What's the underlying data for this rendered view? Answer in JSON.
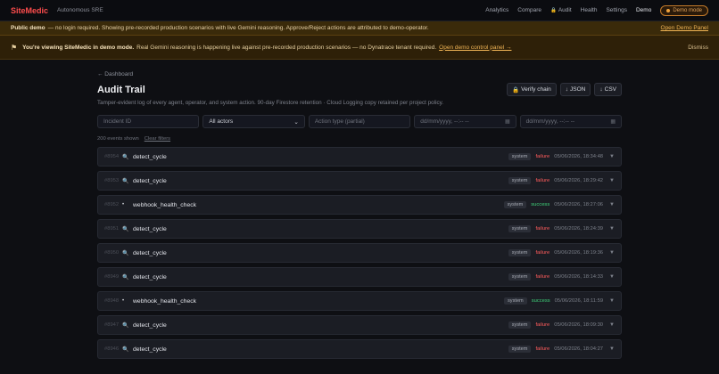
{
  "nav": {
    "brand": "SiteMedic",
    "subtitle": "Autonomous SRE",
    "links": [
      "Analytics",
      "Compare",
      "Audit",
      "Health",
      "Settings",
      "Demo"
    ],
    "demo_pill": "Demo mode"
  },
  "banner_public": {
    "bold": "Public demo",
    "text": "— no login required. Showing pre-recorded production scenarios with live Gemini reasoning. Approve/Reject actions are attributed to demo-operator.",
    "link": "Open Demo Panel"
  },
  "banner_demo": {
    "bold": "You're viewing SiteMedic in demo mode.",
    "text": "Real Gemini reasoning is happening live against pre-recorded production scenarios — no Dynatrace tenant required.",
    "link": "Open demo control panel →",
    "dismiss": "Dismiss"
  },
  "page": {
    "back": "← Dashboard",
    "title": "Audit Trail",
    "verify": "Verify chain",
    "json": "JSON",
    "csv": "CSV",
    "description": "Tamper-evident log of every agent, operator, and system action. 90-day Firestore retention · Cloud Logging copy retained per project policy."
  },
  "filters": {
    "incident_placeholder": "Incident ID",
    "actors_value": "All actors",
    "action_placeholder": "Action type (partial)",
    "date_from": "dd/mm/yyyy, --:-- --",
    "date_to": "dd/mm/yyyy, --:-- --"
  },
  "summary": {
    "count": "200 events shown",
    "clear": "Clear filters"
  },
  "colors": {
    "brand": "#ff4d4d",
    "failure": "#ff5c5c",
    "success": "#3fd27a",
    "banner": "#3a2a0a"
  },
  "events": [
    {
      "id": "#8954",
      "icon": "magnifier-icon",
      "action": "detect_cycle",
      "actor": "system",
      "status": "failure",
      "time": "05/06/2026, 18:34:48"
    },
    {
      "id": "#8953",
      "icon": "magnifier-icon",
      "action": "detect_cycle",
      "actor": "system",
      "status": "failure",
      "time": "05/06/2026, 18:29:42"
    },
    {
      "id": "#8952",
      "icon": "dot-icon",
      "action": "webhook_health_check",
      "actor": "system",
      "status": "success",
      "time": "05/06/2026, 18:27:06"
    },
    {
      "id": "#8951",
      "icon": "magnifier-icon",
      "action": "detect_cycle",
      "actor": "system",
      "status": "failure",
      "time": "05/06/2026, 18:24:39"
    },
    {
      "id": "#8950",
      "icon": "magnifier-icon",
      "action": "detect_cycle",
      "actor": "system",
      "status": "failure",
      "time": "05/06/2026, 18:19:36"
    },
    {
      "id": "#8949",
      "icon": "magnifier-icon",
      "action": "detect_cycle",
      "actor": "system",
      "status": "failure",
      "time": "05/06/2026, 18:14:33"
    },
    {
      "id": "#8948",
      "icon": "dot-icon",
      "action": "webhook_health_check",
      "actor": "system",
      "status": "success",
      "time": "05/06/2026, 18:11:59"
    },
    {
      "id": "#8947",
      "icon": "magnifier-icon",
      "action": "detect_cycle",
      "actor": "system",
      "status": "failure",
      "time": "05/06/2026, 18:09:30"
    },
    {
      "id": "#8946",
      "icon": "magnifier-icon",
      "action": "detect_cycle",
      "actor": "system",
      "status": "failure",
      "time": "05/06/2026, 18:04:27"
    }
  ]
}
